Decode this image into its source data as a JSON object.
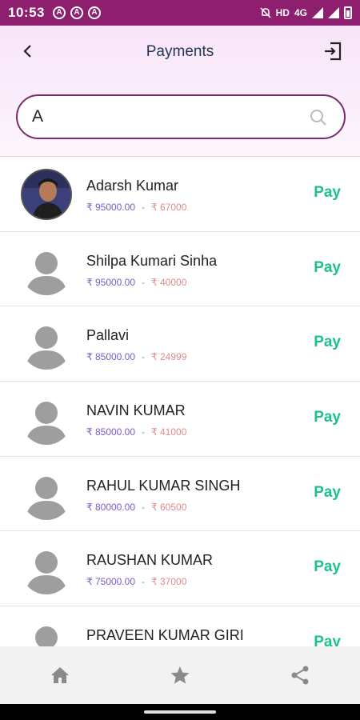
{
  "status_bar": {
    "time": "10:53",
    "left_badges": [
      "A",
      "A",
      "A"
    ],
    "network": "HD",
    "network_type": "4G"
  },
  "header": {
    "title": "Payments",
    "back_icon": "chevron-left-icon",
    "exit_icon": "logout-icon"
  },
  "search": {
    "value": "A",
    "placeholder": ""
  },
  "payees": [
    {
      "name": "Adarsh Kumar",
      "total": "₹ 95000.00",
      "separator": "-",
      "paid": "₹ 67000",
      "pay_label": "Pay",
      "has_photo": true
    },
    {
      "name": "Shilpa Kumari Sinha",
      "total": "₹ 95000.00",
      "separator": "-",
      "paid": "₹ 40000",
      "pay_label": "Pay",
      "has_photo": false
    },
    {
      "name": "Pallavi",
      "total": "₹ 85000.00",
      "separator": "-",
      "paid": "₹ 24999",
      "pay_label": "Pay",
      "has_photo": false
    },
    {
      "name": "NAVIN KUMAR",
      "total": "₹ 85000.00",
      "separator": "-",
      "paid": "₹ 41000",
      "pay_label": "Pay",
      "has_photo": false
    },
    {
      "name": "RAHUL KUMAR SINGH",
      "total": "₹ 80000.00",
      "separator": "-",
      "paid": "₹ 60500",
      "pay_label": "Pay",
      "has_photo": false
    },
    {
      "name": "RAUSHAN KUMAR",
      "total": "₹ 75000.00",
      "separator": "-",
      "paid": "₹ 37000",
      "pay_label": "Pay",
      "has_photo": false
    },
    {
      "name": "PRAVEEN KUMAR GIRI",
      "total": "",
      "separator": "",
      "paid": "",
      "pay_label": "Pay",
      "has_photo": false
    }
  ],
  "bottom_nav": [
    {
      "icon": "home-icon"
    },
    {
      "icon": "star-icon"
    },
    {
      "icon": "share-icon"
    }
  ],
  "colors": {
    "status_bar": "#8e1f6e",
    "accent_border": "#7a2a6e",
    "pay": "#1cbf8f",
    "amount_total": "#7b5cc4",
    "amount_paid": "#e08a8a"
  }
}
